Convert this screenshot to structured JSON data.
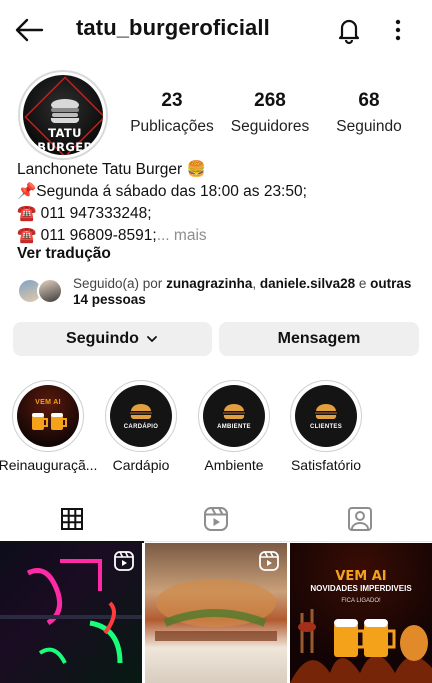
{
  "header": {
    "username": "tatu_burgeroficiall"
  },
  "profile": {
    "avatar_text": "TATU BURGER",
    "stats": [
      {
        "value": "23",
        "label": "Publicações"
      },
      {
        "value": "268",
        "label": "Seguidores"
      },
      {
        "value": "68",
        "label": "Seguindo"
      }
    ],
    "bio_lines": [
      "Lanchonete Tatu Burger 🍔",
      "📌Segunda á sábado das 18:00 as 23:50;",
      "☎️ 011 947333248;",
      "☎️ 011 96809-8591;"
    ],
    "bio_more": "... mais",
    "translate": "Ver tradução",
    "followed_prefix": "Seguido(a) por ",
    "followed_user1": "zunagrazinha",
    "followed_sep": ", ",
    "followed_user2": "daniele.silva28",
    "followed_and": " e ",
    "followed_others": "outras 14 pessoas"
  },
  "buttons": {
    "following": "Seguindo",
    "message": "Mensagem"
  },
  "highlights": [
    {
      "label": "Reinauguraçã...",
      "mini": "VEM AI"
    },
    {
      "label": "Cardápio",
      "mini": "CARDÁPIO"
    },
    {
      "label": "Ambiente",
      "mini": "AMBIENTE"
    },
    {
      "label": "Satisfatório",
      "mini": "CLIENTES"
    }
  ],
  "posts": [
    {
      "kind": "reel",
      "text": ""
    },
    {
      "kind": "reel",
      "text": ""
    },
    {
      "kind": "image",
      "line1": "VEM AI",
      "line2": "NOVIDADES IMPERDIVEIS",
      "line3": "FICA LIGADO!"
    }
  ],
  "colors": {
    "accent_orange": "#f5a21b",
    "button_bg": "#efefef",
    "muted": "#8e8e8e"
  }
}
